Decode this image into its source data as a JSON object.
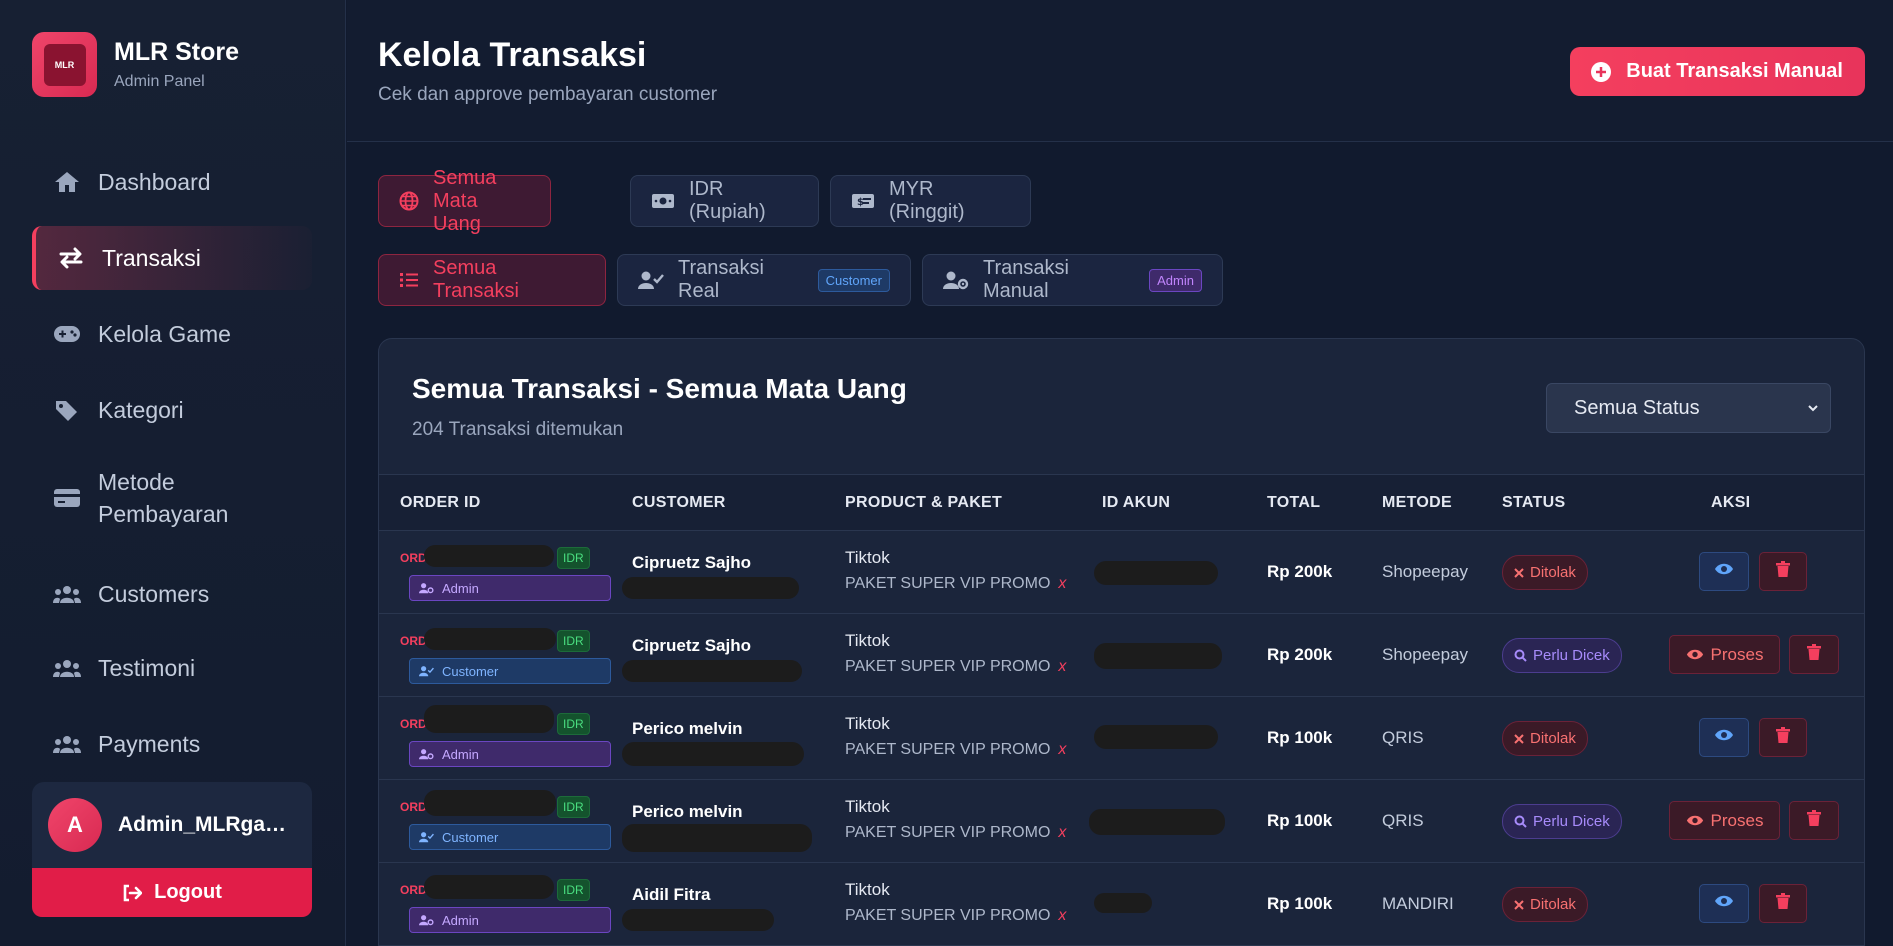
{
  "brand": {
    "name": "MLR Store",
    "subtitle": "Admin Panel",
    "logo_text": "MLR"
  },
  "nav": [
    {
      "label": "Dashboard",
      "icon": "home-icon",
      "active": false
    },
    {
      "label": "Transaksi",
      "icon": "exchange-icon",
      "active": true
    },
    {
      "label": "Kelola Game",
      "icon": "gamepad-icon",
      "active": false
    },
    {
      "label": "Kategori",
      "icon": "tag-icon",
      "active": false
    },
    {
      "label": "Metode",
      "label2": "Pembayaran",
      "icon": "card-icon",
      "active": false
    },
    {
      "label": "Customers",
      "icon": "users-icon",
      "active": false
    },
    {
      "label": "Testimoni",
      "icon": "users-icon",
      "active": false
    },
    {
      "label": "Payments",
      "icon": "users-icon",
      "active": false
    }
  ],
  "user": {
    "initial": "A",
    "name": "Admin_MLRgame..."
  },
  "logout_label": "Logout",
  "header": {
    "title": "Kelola Transaksi",
    "subtitle": "Cek dan approve pembayaran customer",
    "manual_button": "Buat Transaksi Manual"
  },
  "currency_tabs": [
    {
      "label": "Semua Mata Uang",
      "active": true
    },
    {
      "label": "IDR (Rupiah)",
      "active": false
    },
    {
      "label": "MYR (Ringgit)",
      "active": false
    }
  ],
  "type_tabs": [
    {
      "label": "Semua Transaksi",
      "active": true
    },
    {
      "label": "Transaksi Real",
      "chip": "Customer",
      "active": false
    },
    {
      "label": "Transaksi Manual",
      "chip": "Admin",
      "active": false
    }
  ],
  "card": {
    "title": "Semua Transaksi - Semua Mata Uang",
    "count": "204 Transaksi ditemukan",
    "status_filter": "Semua Status"
  },
  "columns": [
    "ORDER ID",
    "CUSTOMER",
    "PRODUCT & PAKET",
    "ID AKUN",
    "TOTAL",
    "METODE",
    "STATUS",
    "AKSI"
  ],
  "rows": [
    {
      "order_prefix": "ORD",
      "currency": "IDR",
      "type": "Admin",
      "customer": "Cipruetz Sajho",
      "product": "Tiktok",
      "paket": "PAKET SUPER VIP PROMO",
      "paket_mark": "x",
      "total": "Rp 200k",
      "metode": "Shopeepay",
      "status": "Ditolak",
      "action": "view"
    },
    {
      "order_prefix": "ORD",
      "currency": "IDR",
      "type": "Customer",
      "customer": "Cipruetz Sajho",
      "product": "Tiktok",
      "paket": "PAKET SUPER VIP PROMO",
      "paket_mark": "x",
      "total": "Rp 200k",
      "metode": "Shopeepay",
      "status": "Perlu Dicek",
      "action": "Proses"
    },
    {
      "order_prefix": "ORD",
      "currency": "IDR",
      "type": "Admin",
      "customer": "Perico melvin",
      "product": "Tiktok",
      "paket": "PAKET SUPER VIP PROMO",
      "paket_mark": "x",
      "total": "Rp 100k",
      "metode": "QRIS",
      "status": "Ditolak",
      "action": "view"
    },
    {
      "order_prefix": "ORD-",
      "currency": "IDR",
      "type": "Customer",
      "customer": "Perico melvin",
      "product": "Tiktok",
      "paket": "PAKET SUPER VIP PROMO",
      "paket_mark": "x",
      "total": "Rp 100k",
      "metode": "QRIS",
      "status": "Perlu Dicek",
      "action": "Proses"
    },
    {
      "order_prefix": "ORD-",
      "currency": "IDR",
      "type": "Admin",
      "customer": "Aidil Fitra",
      "product": "Tiktok",
      "paket": "PAKET SUPER VIP PROMO",
      "paket_mark": "x",
      "total": "Rp 100k",
      "metode": "MANDIRI",
      "status": "Ditolak",
      "action": "view"
    }
  ],
  "colors": {
    "accent": "#f43f5e",
    "background": "#111a2e",
    "card": "#1b253b"
  }
}
